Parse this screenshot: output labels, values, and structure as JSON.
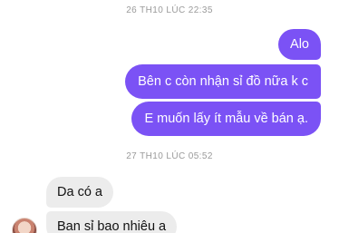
{
  "conversation": {
    "timestamps": [
      "26 TH10 LÚC 22:35",
      "27 TH10 LÚC 05:52"
    ],
    "outgoing": [
      "Alo",
      "Bên c còn nhận sỉ đồ nữa k c",
      "E muốn lấy ít mẫu về bán ạ."
    ],
    "incoming": [
      "Da có a",
      "Ban sỉ bao nhiêu a"
    ]
  },
  "colors": {
    "outgoing_bubble": "#7b52f5",
    "incoming_bubble": "#ececec",
    "timestamp_text": "#9a9a9a"
  },
  "icons": {
    "sender_avatar": "avatar-icon"
  }
}
